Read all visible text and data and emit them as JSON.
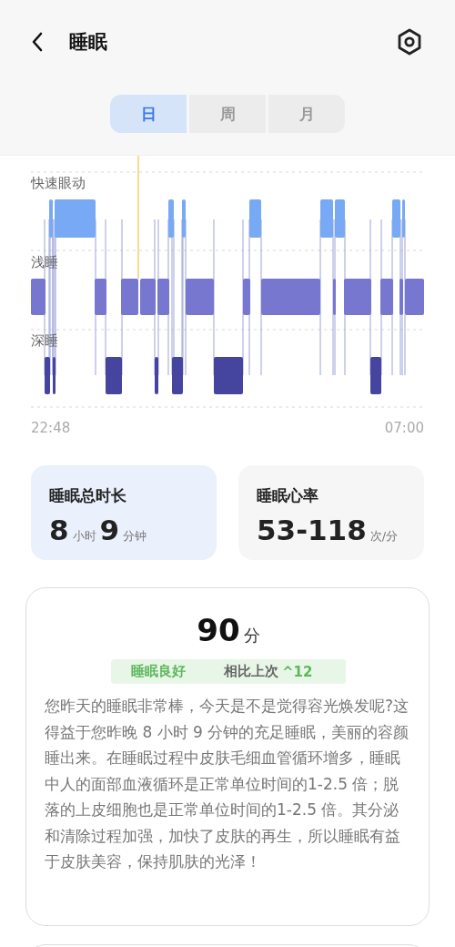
{
  "header": {
    "title": "睡眠"
  },
  "tabs": [
    {
      "label": "日",
      "selected": true
    },
    {
      "label": "周",
      "selected": false
    },
    {
      "label": "月",
      "selected": false
    }
  ],
  "chart": {
    "stages": [
      "快速眼动",
      "浅睡",
      "深睡"
    ],
    "start_time": "22:48",
    "end_time": "07:00"
  },
  "summary_cards": [
    {
      "title": "睡眠总时长",
      "selected": true,
      "value": [
        {
          "kind": "number",
          "text": "8"
        },
        {
          "kind": "unit",
          "text": "小时"
        },
        {
          "kind": "number",
          "text": "9"
        },
        {
          "kind": "unit",
          "text": "分钟"
        }
      ]
    },
    {
      "title": "睡眠心率",
      "selected": false,
      "value": [
        {
          "kind": "number",
          "text": "53-118"
        },
        {
          "kind": "unit",
          "text": "次/分"
        }
      ]
    }
  ],
  "score": {
    "value": "90",
    "unit": "分",
    "rating": "睡眠良好",
    "compare_label": "相比上次",
    "change_arrow": "^",
    "change": "12",
    "description": "您昨天的睡眠非常棒，今天是不是觉得容光焕发呢?这得益于您昨晚 8 小时 9 分钟的充足睡眠，美丽的容颜睡出来。在睡眠过程中皮肤毛细血管循环增多，睡眠中人的面部血液循环是正常单位时间的1-2.5 倍；脱落的上皮细胞也是正常单位时间的1-2.5 倍。其分泌和清除过程加强，加快了皮肤的再生，所以睡眠有益于皮肤美容，保持肌肤的光泽！"
  }
}
